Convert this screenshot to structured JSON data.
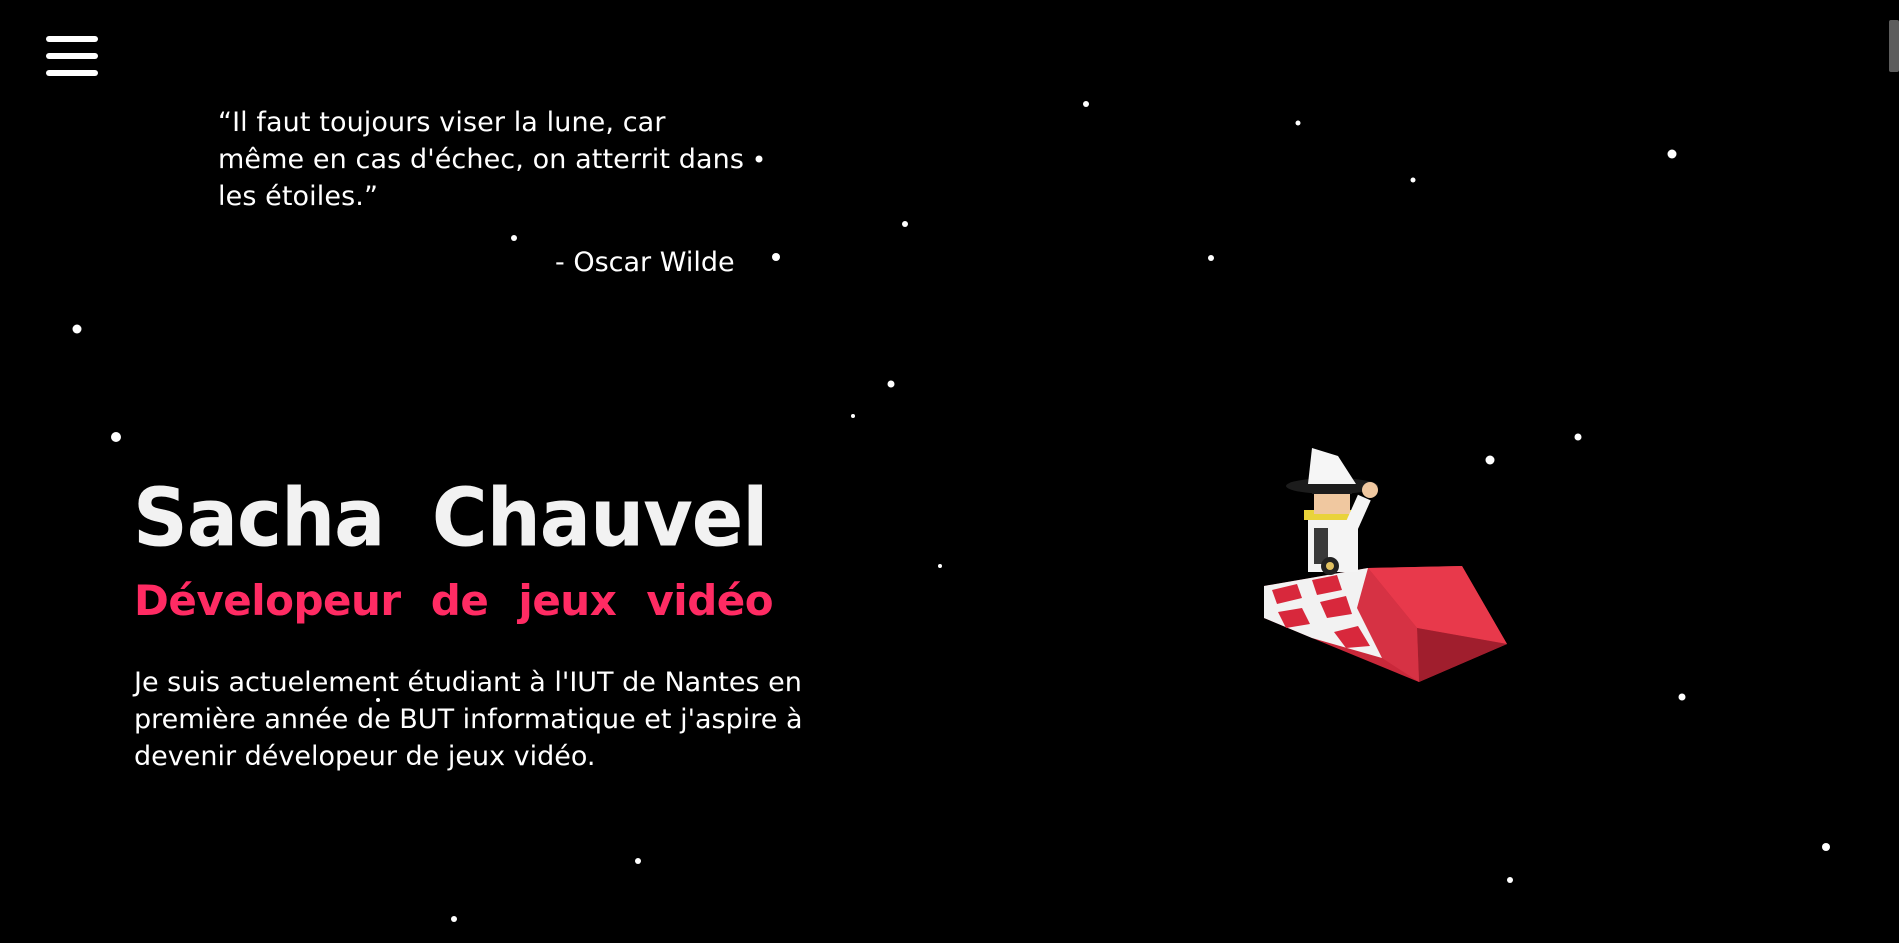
{
  "menu": {
    "icon": "hamburger-menu-icon"
  },
  "quote": {
    "text": "“Il faut toujours viser la lune, car même en cas d'échec, on atterrit dans les étoiles.”",
    "author": "- Oscar Wilde"
  },
  "hero": {
    "name": "Sacha Chauvel",
    "role": "Dévelopeur de jeux vidéo",
    "bio": "Je suis actuelement étudiant à l'IUT de Nantes en première année de BUT informatique et j'aspire à devenir dévelopeur de jeux vidéo."
  },
  "colors": {
    "background": "#000000",
    "text": "#ffffff",
    "accent": "#ff2b63"
  },
  "illustration": {
    "icon": "wizard-on-rocket-icon"
  }
}
